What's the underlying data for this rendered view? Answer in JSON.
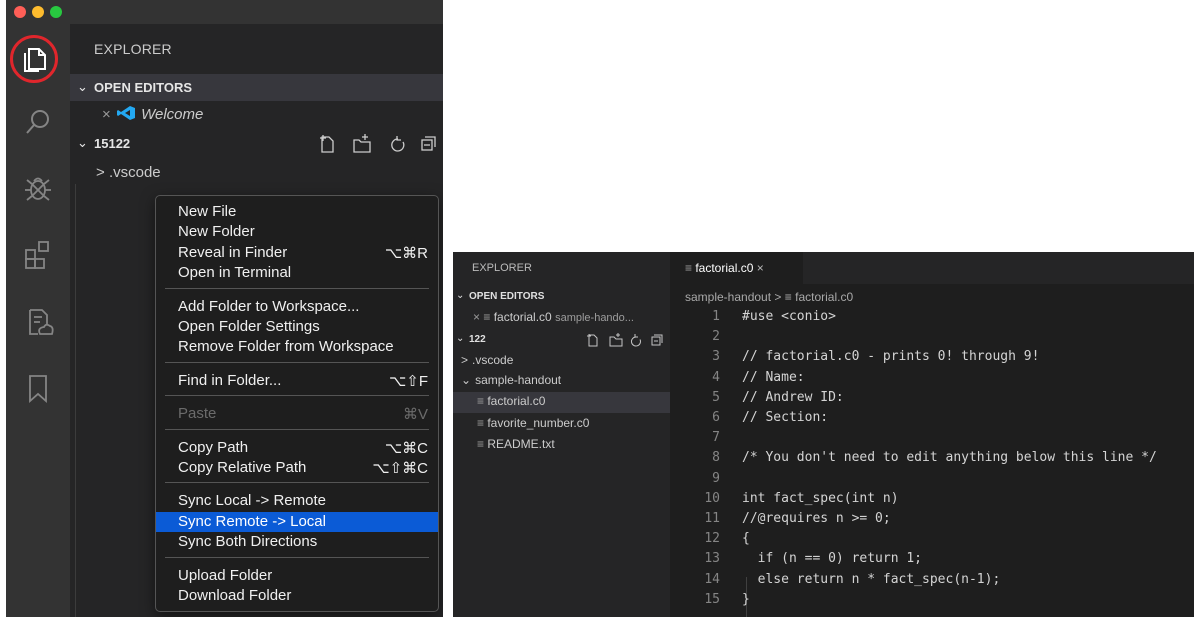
{
  "left": {
    "explorer_title": "EXPLORER",
    "open_editors_label": "OPEN EDITORS",
    "open_editor_item": {
      "close": "×",
      "name": "Welcome"
    },
    "folder_label": "15122",
    "folder_children": [
      {
        "chevron": ">",
        "name": ".vscode"
      }
    ],
    "activity_icons": [
      "files-icon",
      "search-icon",
      "debug-icon",
      "extensions-icon",
      "remote-icon",
      "bookmark-icon"
    ],
    "context_menu": {
      "groups": [
        [
          {
            "label": "New File",
            "shortcut": ""
          },
          {
            "label": "New Folder",
            "shortcut": ""
          },
          {
            "label": "Reveal in Finder",
            "shortcut": "⌥⌘R"
          },
          {
            "label": "Open in Terminal",
            "shortcut": ""
          }
        ],
        [
          {
            "label": "Add Folder to Workspace...",
            "shortcut": ""
          },
          {
            "label": "Open Folder Settings",
            "shortcut": ""
          },
          {
            "label": "Remove Folder from Workspace",
            "shortcut": ""
          }
        ],
        [
          {
            "label": "Find in Folder...",
            "shortcut": "⌥⇧F"
          }
        ],
        [
          {
            "label": "Paste",
            "shortcut": "⌘V",
            "disabled": true
          }
        ],
        [
          {
            "label": "Copy Path",
            "shortcut": "⌥⌘C"
          },
          {
            "label": "Copy Relative Path",
            "shortcut": "⌥⇧⌘C"
          }
        ],
        [
          {
            "label": "Sync Local -> Remote",
            "shortcut": ""
          },
          {
            "label": "Sync Remote -> Local",
            "shortcut": "",
            "selected": true
          },
          {
            "label": "Sync Both Directions",
            "shortcut": ""
          }
        ],
        [
          {
            "label": "Upload Folder",
            "shortcut": ""
          },
          {
            "label": "Download Folder",
            "shortcut": ""
          }
        ]
      ]
    },
    "colors": {
      "highlight_ring": "#e0262c",
      "menu_selected": "#0b5bd6"
    }
  },
  "right": {
    "explorer_title": "EXPLORER",
    "open_editors_label": "OPEN EDITORS",
    "open_editor_item": {
      "close": "×",
      "name": "factorial.c0",
      "path": "sample-hando..."
    },
    "folder_label": "122",
    "tree": [
      {
        "chevron": ">",
        "name": ".vscode"
      },
      {
        "chevron": "⌄",
        "name": "sample-handout"
      },
      {
        "name": "factorial.c0",
        "selected": true
      },
      {
        "name": "favorite_number.c0"
      },
      {
        "name": "README.txt"
      }
    ],
    "tab": {
      "name": "factorial.c0",
      "close": "×"
    },
    "breadcrumb": {
      "folder": "sample-handout",
      "sep": ">",
      "file": "factorial.c0"
    },
    "code_lines": [
      "#use <conio>",
      "",
      "// factorial.c0 - prints 0! through 9!",
      "// Name:",
      "// Andrew ID:",
      "// Section:",
      "",
      "/* You don't need to edit anything below this line */",
      "",
      "int fact_spec(int n)",
      "//@requires n >= 0;",
      "{",
      "  if (n == 0) return 1;",
      "  else return n * fact_spec(n-1);",
      "}"
    ]
  }
}
